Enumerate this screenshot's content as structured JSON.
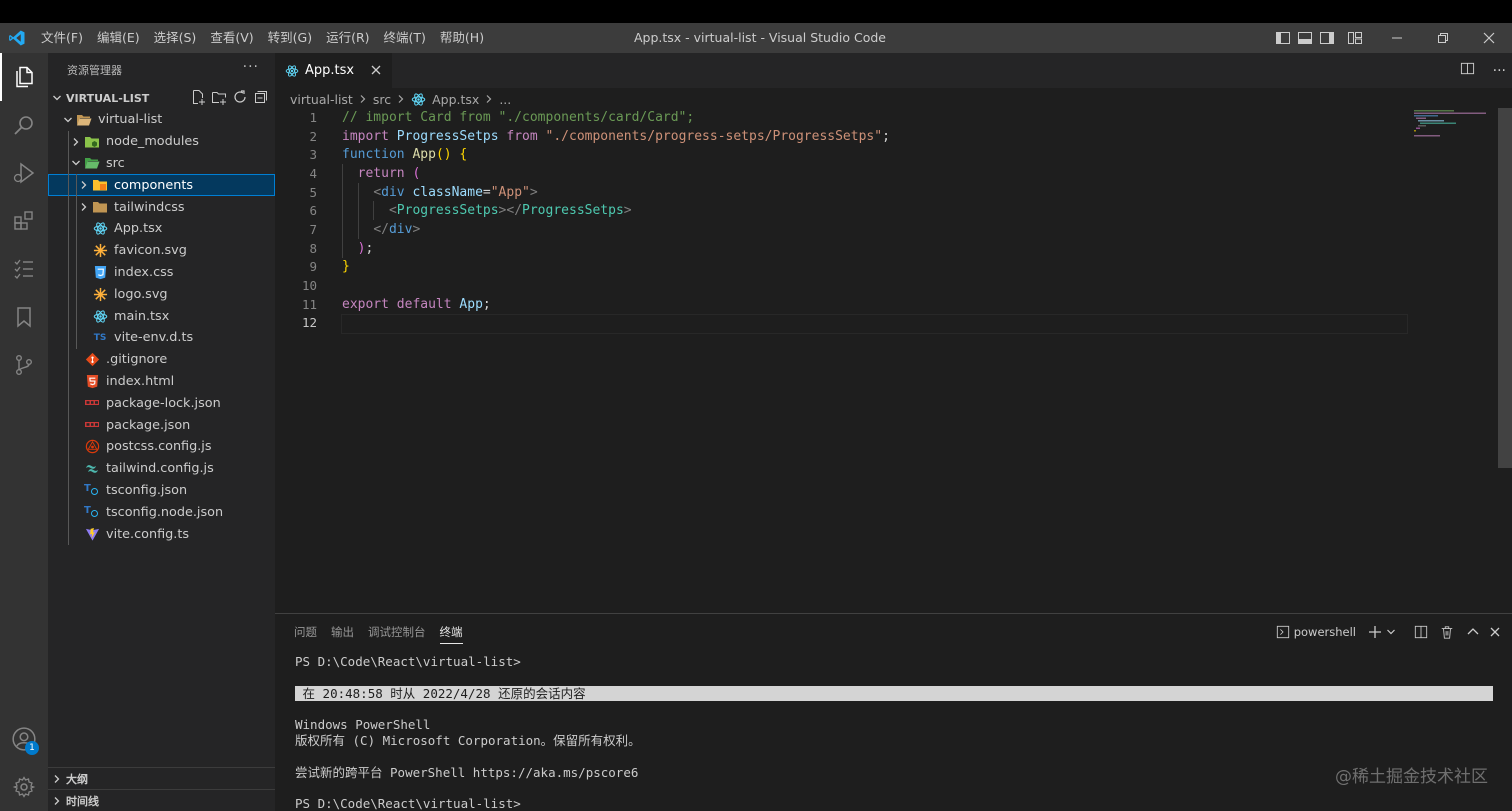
{
  "window": {
    "title": "App.tsx - virtual-list - Visual Studio Code"
  },
  "menu": [
    "文件(F)",
    "编辑(E)",
    "选择(S)",
    "查看(V)",
    "转到(G)",
    "运行(R)",
    "终端(T)",
    "帮助(H)"
  ],
  "activity": {
    "accounts_badge": "1"
  },
  "sidebar": {
    "header": "资源管理器",
    "more": "···",
    "section": "VIRTUAL-LIST",
    "tree": [
      {
        "label": "virtual-list",
        "depth": 0,
        "type": "folder-open",
        "icon": "folder-open-icon"
      },
      {
        "label": "node_modules",
        "depth": 1,
        "type": "folder",
        "icon": "node-folder-icon"
      },
      {
        "label": "src",
        "depth": 1,
        "type": "folder-open",
        "icon": "src-folder-icon"
      },
      {
        "label": "components",
        "depth": 2,
        "type": "folder",
        "icon": "components-folder-icon",
        "selected": true
      },
      {
        "label": "tailwindcss",
        "depth": 2,
        "type": "folder",
        "icon": "folder-icon"
      },
      {
        "label": "App.tsx",
        "depth": 2,
        "type": "file",
        "icon": "react-icon"
      },
      {
        "label": "favicon.svg",
        "depth": 2,
        "type": "file",
        "icon": "svg-icon"
      },
      {
        "label": "index.css",
        "depth": 2,
        "type": "file",
        "icon": "css-icon"
      },
      {
        "label": "logo.svg",
        "depth": 2,
        "type": "file",
        "icon": "svg-icon"
      },
      {
        "label": "main.tsx",
        "depth": 2,
        "type": "file",
        "icon": "react-icon"
      },
      {
        "label": "vite-env.d.ts",
        "depth": 2,
        "type": "file",
        "icon": "typescript-icon"
      },
      {
        "label": ".gitignore",
        "depth": 1,
        "type": "file",
        "icon": "git-icon"
      },
      {
        "label": "index.html",
        "depth": 1,
        "type": "file",
        "icon": "html-icon"
      },
      {
        "label": "package-lock.json",
        "depth": 1,
        "type": "file",
        "icon": "npm-icon"
      },
      {
        "label": "package.json",
        "depth": 1,
        "type": "file",
        "icon": "npm-icon"
      },
      {
        "label": "postcss.config.js",
        "depth": 1,
        "type": "file",
        "icon": "postcss-icon"
      },
      {
        "label": "tailwind.config.js",
        "depth": 1,
        "type": "file",
        "icon": "tailwind-icon"
      },
      {
        "label": "tsconfig.json",
        "depth": 1,
        "type": "file",
        "icon": "tsconfig-icon"
      },
      {
        "label": "tsconfig.node.json",
        "depth": 1,
        "type": "file",
        "icon": "tsconfig-icon"
      },
      {
        "label": "vite.config.ts",
        "depth": 1,
        "type": "file",
        "icon": "vite-icon"
      }
    ],
    "outline": "大纲",
    "timeline": "时间线"
  },
  "editor": {
    "tab": "App.tsx",
    "breadcrumb": [
      "virtual-list",
      "src",
      "App.tsx",
      "..."
    ],
    "current_line": 12,
    "lines": [
      {
        "n": "1",
        "guides": 0,
        "t": [
          [
            "c-com",
            "// import Card from \"./components/card/Card\";"
          ]
        ]
      },
      {
        "n": "2",
        "guides": 0,
        "t": [
          [
            "c-kw",
            "import"
          ],
          [
            "c-pl",
            " "
          ],
          [
            "c-id",
            "ProgressSetps"
          ],
          [
            "c-pl",
            " "
          ],
          [
            "c-kw",
            "from"
          ],
          [
            "c-pl",
            " "
          ],
          [
            "c-str",
            "\"./components/progress-setps/ProgressSetps\""
          ],
          [
            "c-pl",
            ";"
          ]
        ]
      },
      {
        "n": "3",
        "guides": 0,
        "t": [
          [
            "c-kw2",
            "function"
          ],
          [
            "c-pl",
            " "
          ],
          [
            "c-fn",
            "App"
          ],
          [
            "c-br",
            "()"
          ],
          [
            "c-pl",
            " "
          ],
          [
            "c-br",
            "{"
          ]
        ]
      },
      {
        "n": "4",
        "guides": 1,
        "t": [
          [
            "c-pl",
            "  "
          ],
          [
            "c-kw",
            "return"
          ],
          [
            "c-pl",
            " "
          ],
          [
            "c-br2",
            "("
          ]
        ]
      },
      {
        "n": "5",
        "guides": 2,
        "t": [
          [
            "c-pl",
            "    "
          ],
          [
            "c-pt",
            "<"
          ],
          [
            "c-kw2",
            "div"
          ],
          [
            "c-pl",
            " "
          ],
          [
            "c-id",
            "className"
          ],
          [
            "c-pl",
            "="
          ],
          [
            "c-str",
            "\"App\""
          ],
          [
            "c-pt",
            ">"
          ]
        ]
      },
      {
        "n": "6",
        "guides": 3,
        "t": [
          [
            "c-pl",
            "      "
          ],
          [
            "c-pt",
            "<"
          ],
          [
            "c-tag",
            "ProgressSetps"
          ],
          [
            "c-pt",
            "></"
          ],
          [
            "c-tag",
            "ProgressSetps"
          ],
          [
            "c-pt",
            ">"
          ]
        ]
      },
      {
        "n": "7",
        "guides": 2,
        "t": [
          [
            "c-pl",
            "    "
          ],
          [
            "c-pt",
            "</"
          ],
          [
            "c-kw2",
            "div"
          ],
          [
            "c-pt",
            ">"
          ]
        ]
      },
      {
        "n": "8",
        "guides": 1,
        "t": [
          [
            "c-pl",
            "  "
          ],
          [
            "c-br2",
            ")"
          ],
          [
            "c-pl",
            ";"
          ]
        ]
      },
      {
        "n": "9",
        "guides": 0,
        "t": [
          [
            "c-br",
            "}"
          ]
        ]
      },
      {
        "n": "10",
        "guides": 0,
        "t": []
      },
      {
        "n": "11",
        "guides": 0,
        "t": [
          [
            "c-kw",
            "export"
          ],
          [
            "c-pl",
            " "
          ],
          [
            "c-kw",
            "default"
          ],
          [
            "c-pl",
            " "
          ],
          [
            "c-id",
            "App"
          ],
          [
            "c-pl",
            ";"
          ]
        ]
      },
      {
        "n": "12",
        "guides": 0,
        "t": []
      }
    ]
  },
  "panel": {
    "tabs": [
      "问题",
      "输出",
      "调试控制台",
      "终端"
    ],
    "active_tab": "终端",
    "shell": "powershell",
    "terminal": [
      {
        "text": "PS D:\\Code\\React\\virtual-list>",
        "style": ""
      },
      {
        "text": "",
        "style": ""
      },
      {
        "text": " 在 20:48:58 时从 2022/4/28 还原的会话内容",
        "style": "restored"
      },
      {
        "text": "",
        "style": ""
      },
      {
        "text": "Windows PowerShell",
        "style": ""
      },
      {
        "text": "版权所有 (C) Microsoft Corporation。保留所有权利。",
        "style": ""
      },
      {
        "text": "",
        "style": ""
      },
      {
        "text": "尝试新的跨平台 PowerShell https://aka.ms/pscore6",
        "style": ""
      },
      {
        "text": "",
        "style": ""
      },
      {
        "text": "PS D:\\Code\\React\\virtual-list>",
        "style": ""
      }
    ]
  },
  "watermark": "@稀土掘金技术社区",
  "colors": {
    "accent": "#007acc",
    "titlebar": "#3c3c3c",
    "sidebar": "#252526",
    "editor": "#1e1e1e",
    "activitybar": "#333333"
  }
}
